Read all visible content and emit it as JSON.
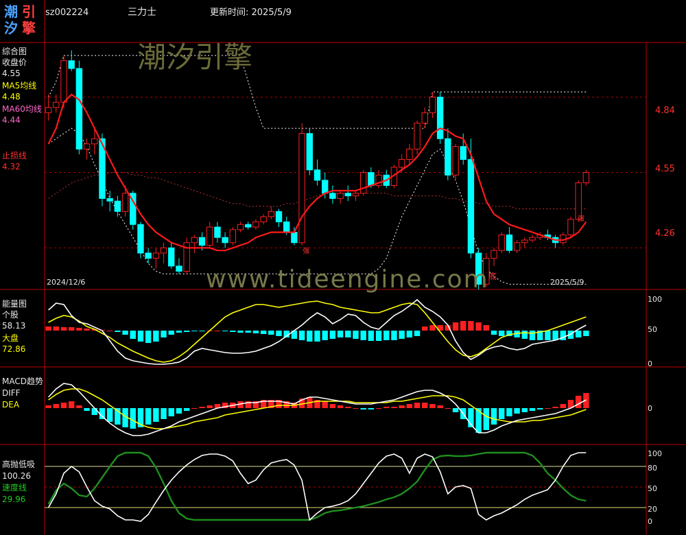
{
  "header": {
    "logo_chars": [
      "潮",
      "引",
      "汐",
      "擎"
    ],
    "code": "sz002224",
    "name": "三力士",
    "update_label": "更新时间: 2025/5/9"
  },
  "watermarks": {
    "cn": "潮汐引擎",
    "url": "www.tideengine.com"
  },
  "panel_main": {
    "title": "综合图",
    "close_label": "收盘价",
    "close_value": "4.55",
    "ma5_label": "MA5均线",
    "ma5_value": "4.48",
    "ma60_label": "MA60均线",
    "ma60_value": "4.44",
    "stop_label": "止损线",
    "stop_value": "4.32",
    "date_start": "2024/12/6",
    "date_end": "2025/5/9",
    "mark_qiang": "强",
    "mark_di": "底"
  },
  "panel_energy": {
    "title": "能量图",
    "stock_label": "个股",
    "stock_value": "58.13",
    "market_label": "大盘",
    "market_value": "72.86"
  },
  "panel_macd": {
    "title": "MACD趋势",
    "diff_label": "DIFF",
    "dea_label": "DEA"
  },
  "panel_osc": {
    "title": "高抛低吸",
    "value": "100.26",
    "speed_label": "速度线",
    "speed_value": "29.96"
  },
  "colors": {
    "up": "#ff2020",
    "down": "#00ffff",
    "ma60": "#ff1a1a",
    "border": "#c00000",
    "yellow": "#ffff00",
    "green": "#1f8f1f"
  },
  "chart_data": [
    {
      "type": "candlestick",
      "title": "综合图",
      "yticks": [
        "4.84",
        "4.55",
        "4.26"
      ],
      "ylim": [
        4.1,
        5.05
      ],
      "x_start": "2024/12/6",
      "x_end": "2025/5/9",
      "candles": [
        [
          4.78,
          4.85,
          4.75,
          4.8
        ],
        [
          4.8,
          4.85,
          4.78,
          4.82
        ],
        [
          4.82,
          5.0,
          4.8,
          4.98
        ],
        [
          4.98,
          5.02,
          4.94,
          4.95
        ],
        [
          4.95,
          4.98,
          4.62,
          4.64
        ],
        [
          4.64,
          4.68,
          4.6,
          4.66
        ],
        [
          4.66,
          4.72,
          4.62,
          4.68
        ],
        [
          4.68,
          4.7,
          4.42,
          4.45
        ],
        [
          4.45,
          4.48,
          4.4,
          4.44
        ],
        [
          4.44,
          4.46,
          4.38,
          4.4
        ],
        [
          4.4,
          4.5,
          4.38,
          4.47
        ],
        [
          4.47,
          4.48,
          4.33,
          4.35
        ],
        [
          4.35,
          4.36,
          4.22,
          4.24
        ],
        [
          4.24,
          4.26,
          4.2,
          4.22
        ],
        [
          4.22,
          4.26,
          4.18,
          4.24
        ],
        [
          4.24,
          4.28,
          4.2,
          4.26
        ],
        [
          4.26,
          4.28,
          4.18,
          4.19
        ],
        [
          4.19,
          4.22,
          4.16,
          4.17
        ],
        [
          4.17,
          4.3,
          4.16,
          4.28
        ],
        [
          4.28,
          4.31,
          4.24,
          4.3
        ],
        [
          4.3,
          4.32,
          4.25,
          4.27
        ],
        [
          4.27,
          4.36,
          4.26,
          4.34
        ],
        [
          4.34,
          4.36,
          4.28,
          4.3
        ],
        [
          4.3,
          4.32,
          4.26,
          4.28
        ],
        [
          4.28,
          4.34,
          4.27,
          4.33
        ],
        [
          4.33,
          4.36,
          4.32,
          4.35
        ],
        [
          4.35,
          4.36,
          4.33,
          4.34
        ],
        [
          4.34,
          4.37,
          4.33,
          4.36
        ],
        [
          4.36,
          4.39,
          4.35,
          4.38
        ],
        [
          4.38,
          4.42,
          4.37,
          4.4
        ],
        [
          4.4,
          4.41,
          4.34,
          4.36
        ],
        [
          4.36,
          4.38,
          4.31,
          4.32
        ],
        [
          4.32,
          4.34,
          4.27,
          4.28
        ],
        [
          4.28,
          4.74,
          4.27,
          4.7
        ],
        [
          4.7,
          4.72,
          4.54,
          4.56
        ],
        [
          4.56,
          4.6,
          4.5,
          4.52
        ],
        [
          4.52,
          4.55,
          4.45,
          4.47
        ],
        [
          4.47,
          4.5,
          4.43,
          4.45
        ],
        [
          4.45,
          4.48,
          4.43,
          4.47
        ],
        [
          4.47,
          4.5,
          4.44,
          4.46
        ],
        [
          4.46,
          4.48,
          4.44,
          4.47
        ],
        [
          4.47,
          4.56,
          4.46,
          4.55
        ],
        [
          4.55,
          4.57,
          4.49,
          4.5
        ],
        [
          4.5,
          4.56,
          4.49,
          4.54
        ],
        [
          4.54,
          4.56,
          4.49,
          4.5
        ],
        [
          4.5,
          4.58,
          4.49,
          4.57
        ],
        [
          4.57,
          4.62,
          4.55,
          4.6
        ],
        [
          4.6,
          4.66,
          4.58,
          4.64
        ],
        [
          4.64,
          4.75,
          4.62,
          4.74
        ],
        [
          4.74,
          4.8,
          4.72,
          4.78
        ],
        [
          4.78,
          4.86,
          4.76,
          4.84
        ],
        [
          4.84,
          4.86,
          4.66,
          4.68
        ],
        [
          4.68,
          4.72,
          4.52,
          4.54
        ],
        [
          4.54,
          4.66,
          4.52,
          4.65
        ],
        [
          4.65,
          4.7,
          4.58,
          4.6
        ],
        [
          4.6,
          4.68,
          4.22,
          4.24
        ],
        [
          4.24,
          4.26,
          4.1,
          4.12
        ],
        [
          4.12,
          4.24,
          4.11,
          4.22
        ],
        [
          4.22,
          4.26,
          4.19,
          4.25
        ],
        [
          4.25,
          4.32,
          4.24,
          4.31
        ],
        [
          4.31,
          4.34,
          4.24,
          4.25
        ],
        [
          4.25,
          4.29,
          4.24,
          4.28
        ],
        [
          4.28,
          4.3,
          4.26,
          4.29
        ],
        [
          4.29,
          4.31,
          4.28,
          4.3
        ],
        [
          4.3,
          4.32,
          4.29,
          4.31
        ],
        [
          4.31,
          4.33,
          4.29,
          4.3
        ],
        [
          4.3,
          4.31,
          4.26,
          4.28
        ],
        [
          4.28,
          4.32,
          4.27,
          4.31
        ],
        [
          4.31,
          4.38,
          4.3,
          4.37
        ],
        [
          4.37,
          4.52,
          4.36,
          4.51
        ],
        [
          4.51,
          4.56,
          4.5,
          4.55
        ]
      ],
      "ma60": [
        4.66,
        4.72,
        4.82,
        4.85,
        4.83,
        4.78,
        4.72,
        4.66,
        4.6,
        4.54,
        4.49,
        4.44,
        4.39,
        4.35,
        4.32,
        4.3,
        4.28,
        4.27,
        4.26,
        4.26,
        4.26,
        4.26,
        4.25,
        4.25,
        4.26,
        4.27,
        4.28,
        4.3,
        4.31,
        4.32,
        4.32,
        4.32,
        4.32,
        4.38,
        4.42,
        4.45,
        4.47,
        4.48,
        4.48,
        4.48,
        4.48,
        4.49,
        4.5,
        4.51,
        4.52,
        4.54,
        4.56,
        4.58,
        4.61,
        4.65,
        4.7,
        4.72,
        4.71,
        4.69,
        4.68,
        4.62,
        4.53,
        4.44,
        4.39,
        4.37,
        4.35,
        4.34,
        4.33,
        4.32,
        4.31,
        4.3,
        4.29,
        4.29,
        4.3,
        4.32,
        4.36
      ],
      "upper_band": [
        4.84,
        4.9,
        5.0,
        5.0,
        5.0,
        5.0,
        5.0,
        5.0,
        5.0,
        5.0,
        5.0,
        5.0,
        5.0,
        5.0,
        5.0,
        5.0,
        5.0,
        5.0,
        5.0,
        5.0,
        5.0,
        5.0,
        5.0,
        5.0,
        5.0,
        5.0,
        4.9,
        4.8,
        4.72,
        4.72,
        4.72,
        4.72,
        4.72,
        4.72,
        4.72,
        4.72,
        4.72,
        4.72,
        4.72,
        4.72,
        4.72,
        4.72,
        4.72,
        4.72,
        4.72,
        4.72,
        4.72,
        4.72,
        4.72,
        4.72,
        4.86,
        4.86,
        4.86,
        4.86,
        4.86,
        4.86,
        4.86,
        4.86,
        4.86,
        4.86,
        4.86,
        4.86,
        4.86,
        4.86,
        4.86,
        4.86,
        4.86,
        4.86,
        4.86,
        4.86,
        4.86
      ],
      "lower_band": [
        4.66,
        4.68,
        4.7,
        4.72,
        4.7,
        4.65,
        4.58,
        4.52,
        4.45,
        4.4,
        4.35,
        4.3,
        4.25,
        4.2,
        4.17,
        4.16,
        4.16,
        4.16,
        4.16,
        4.16,
        4.16,
        4.16,
        4.16,
        4.16,
        4.16,
        4.16,
        4.16,
        4.16,
        4.16,
        4.16,
        4.16,
        4.16,
        4.16,
        4.16,
        4.16,
        4.16,
        4.16,
        4.16,
        4.16,
        4.16,
        4.16,
        4.16,
        4.16,
        4.18,
        4.22,
        4.3,
        4.38,
        4.44,
        4.5,
        4.56,
        4.62,
        4.64,
        4.58,
        4.52,
        4.44,
        4.34,
        4.24,
        4.18,
        4.15,
        4.13,
        4.12,
        4.12,
        4.12,
        4.12,
        4.12,
        4.12,
        4.12,
        4.12,
        4.12,
        4.12,
        4.12
      ],
      "ma_mid": [
        4.45,
        4.47,
        4.49,
        4.51,
        4.52,
        4.53,
        4.54,
        4.54,
        4.55,
        4.55,
        4.55,
        4.54,
        4.54,
        4.53,
        4.53,
        4.52,
        4.51,
        4.5,
        4.49,
        4.48,
        4.47,
        4.46,
        4.45,
        4.44,
        4.43,
        4.43,
        4.42,
        4.42,
        4.42,
        4.42,
        4.42,
        4.43,
        4.43,
        4.44,
        4.45,
        4.46,
        4.47,
        4.47,
        4.47,
        4.47,
        4.47,
        4.47,
        4.47,
        4.47,
        4.47,
        4.46,
        4.46,
        4.46,
        4.46,
        4.46,
        4.46,
        4.46,
        4.45,
        4.45,
        4.44,
        4.44,
        4.43,
        4.43,
        4.42,
        4.42,
        4.42,
        4.41,
        4.41,
        4.41,
        4.41,
        4.41,
        4.41,
        4.41,
        4.41,
        4.41,
        4.41
      ],
      "hlines": [
        4.84,
        4.55,
        4.26
      ]
    },
    {
      "type": "bar+line",
      "title": "能量图",
      "yticks": [
        "100",
        "50",
        "0"
      ],
      "ylim": [
        0,
        100
      ],
      "bars_signed": [
        6,
        6,
        5,
        5,
        4,
        3,
        2,
        1,
        0,
        -2,
        -6,
        -12,
        -16,
        -18,
        -16,
        -10,
        -6,
        -3,
        -2,
        -1,
        -1,
        0,
        0,
        -1,
        -2,
        -3,
        -3,
        -4,
        -5,
        -6,
        -8,
        -10,
        -12,
        -14,
        -16,
        -16,
        -14,
        -12,
        -10,
        -10,
        -12,
        -14,
        -15,
        -15,
        -14,
        -14,
        -12,
        -10,
        -8,
        6,
        8,
        8,
        8,
        12,
        14,
        14,
        12,
        8,
        -6,
        -8,
        -8,
        -10,
        -12,
        -14,
        -14,
        -14,
        -14,
        -14,
        -12,
        -10,
        -8
      ],
      "white_line": [
        80,
        90,
        88,
        72,
        62,
        60,
        55,
        50,
        35,
        20,
        10,
        6,
        4,
        2,
        1,
        1,
        2,
        4,
        10,
        20,
        24,
        22,
        20,
        18,
        17,
        17,
        18,
        20,
        24,
        28,
        34,
        42,
        50,
        58,
        68,
        76,
        70,
        60,
        66,
        74,
        72,
        62,
        55,
        52,
        62,
        72,
        78,
        86,
        95,
        84,
        78,
        70,
        58,
        35,
        18,
        8,
        14,
        22,
        26,
        28,
        24,
        22,
        24,
        30,
        32,
        34,
        36,
        40,
        45,
        52,
        58
      ],
      "yellow_line": [
        62,
        68,
        72,
        70,
        64,
        56,
        52,
        46,
        40,
        32,
        26,
        20,
        15,
        10,
        6,
        4,
        6,
        12,
        20,
        30,
        40,
        50,
        60,
        70,
        76,
        80,
        84,
        88,
        88,
        86,
        84,
        86,
        88,
        90,
        92,
        93,
        90,
        88,
        84,
        82,
        80,
        78,
        76,
        76,
        80,
        84,
        88,
        90,
        88,
        76,
        62,
        48,
        34,
        22,
        14,
        12,
        16,
        24,
        32,
        40,
        44,
        46,
        47,
        46,
        48,
        50,
        54,
        58,
        62,
        66,
        70
      ]
    },
    {
      "type": "bar+line",
      "title": "MACD趋势",
      "yticks": [
        "0"
      ],
      "ylim": [
        -0.25,
        0.25
      ],
      "bars_signed": [
        0.02,
        0.03,
        0.04,
        0.05,
        0.02,
        -0.02,
        -0.05,
        -0.08,
        -0.1,
        -0.12,
        -0.14,
        -0.15,
        -0.14,
        -0.12,
        -0.1,
        -0.08,
        -0.06,
        -0.04,
        -0.02,
        0.0,
        0.01,
        0.02,
        0.03,
        0.04,
        0.04,
        0.05,
        0.05,
        0.05,
        0.06,
        0.06,
        0.06,
        0.05,
        0.04,
        0.07,
        0.08,
        0.06,
        0.05,
        0.03,
        0.02,
        0.01,
        0.0,
        -0.01,
        -0.01,
        0.0,
        0.01,
        0.01,
        0.02,
        0.03,
        0.04,
        0.04,
        0.03,
        0.02,
        0.0,
        -0.03,
        -0.08,
        -0.14,
        -0.18,
        -0.16,
        -0.12,
        -0.08,
        -0.06,
        -0.04,
        -0.03,
        -0.02,
        -0.01,
        0.0,
        0.01,
        0.03,
        0.06,
        0.09,
        0.11
      ],
      "diff": [
        0.08,
        0.14,
        0.18,
        0.17,
        0.12,
        0.06,
        0.0,
        -0.06,
        -0.11,
        -0.15,
        -0.18,
        -0.2,
        -0.2,
        -0.19,
        -0.17,
        -0.15,
        -0.13,
        -0.1,
        -0.08,
        -0.06,
        -0.04,
        -0.02,
        0.0,
        0.01,
        0.02,
        0.03,
        0.04,
        0.04,
        0.05,
        0.05,
        0.05,
        0.04,
        0.03,
        0.06,
        0.08,
        0.08,
        0.07,
        0.06,
        0.05,
        0.04,
        0.03,
        0.03,
        0.03,
        0.04,
        0.05,
        0.06,
        0.08,
        0.1,
        0.12,
        0.13,
        0.13,
        0.11,
        0.08,
        0.03,
        -0.04,
        -0.12,
        -0.18,
        -0.18,
        -0.16,
        -0.13,
        -0.11,
        -0.09,
        -0.08,
        -0.07,
        -0.06,
        -0.05,
        -0.04,
        -0.02,
        0.0,
        0.03,
        0.06
      ],
      "dea": [
        0.06,
        0.1,
        0.13,
        0.14,
        0.14,
        0.12,
        0.09,
        0.06,
        0.02,
        -0.02,
        -0.06,
        -0.09,
        -0.12,
        -0.14,
        -0.15,
        -0.15,
        -0.14,
        -0.13,
        -0.12,
        -0.1,
        -0.09,
        -0.08,
        -0.07,
        -0.05,
        -0.04,
        -0.03,
        -0.02,
        -0.01,
        0.0,
        0.01,
        0.02,
        0.02,
        0.02,
        0.03,
        0.04,
        0.05,
        0.05,
        0.05,
        0.05,
        0.05,
        0.04,
        0.04,
        0.04,
        0.04,
        0.04,
        0.05,
        0.05,
        0.06,
        0.07,
        0.08,
        0.09,
        0.09,
        0.09,
        0.08,
        0.06,
        0.02,
        -0.02,
        -0.06,
        -0.08,
        -0.09,
        -0.1,
        -0.1,
        -0.1,
        -0.09,
        -0.09,
        -0.08,
        -0.07,
        -0.06,
        -0.05,
        -0.03,
        -0.01
      ]
    },
    {
      "type": "line",
      "title": "高抛低吸",
      "yticks": [
        "100",
        "80",
        "50",
        "20",
        "0"
      ],
      "ylim": [
        0,
        100
      ],
      "hlines": [
        80,
        50,
        20
      ],
      "white_line": [
        20,
        40,
        70,
        80,
        72,
        50,
        30,
        22,
        18,
        8,
        2,
        2,
        0,
        10,
        28,
        45,
        60,
        72,
        82,
        90,
        96,
        98,
        98,
        95,
        88,
        70,
        55,
        60,
        75,
        85,
        88,
        90,
        82,
        60,
        2,
        12,
        20,
        22,
        25,
        30,
        40,
        55,
        70,
        85,
        95,
        98,
        92,
        70,
        92,
        98,
        94,
        72,
        40,
        50,
        52,
        48,
        10,
        2,
        8,
        12,
        18,
        24,
        32,
        38,
        42,
        46,
        60,
        80,
        96,
        100,
        100
      ],
      "green_line": [
        25,
        45,
        55,
        48,
        38,
        36,
        48,
        64,
        80,
        95,
        100,
        100,
        100,
        95,
        78,
        55,
        30,
        12,
        4,
        2,
        2,
        2,
        2,
        2,
        2,
        2,
        2,
        2,
        2,
        2,
        2,
        2,
        2,
        2,
        2,
        6,
        12,
        15,
        16,
        18,
        20,
        22,
        25,
        28,
        32,
        35,
        40,
        48,
        58,
        75,
        90,
        95,
        96,
        95,
        95,
        96,
        98,
        100,
        100,
        100,
        100,
        100,
        100,
        96,
        85,
        70,
        60,
        48,
        38,
        32,
        30
      ]
    }
  ]
}
